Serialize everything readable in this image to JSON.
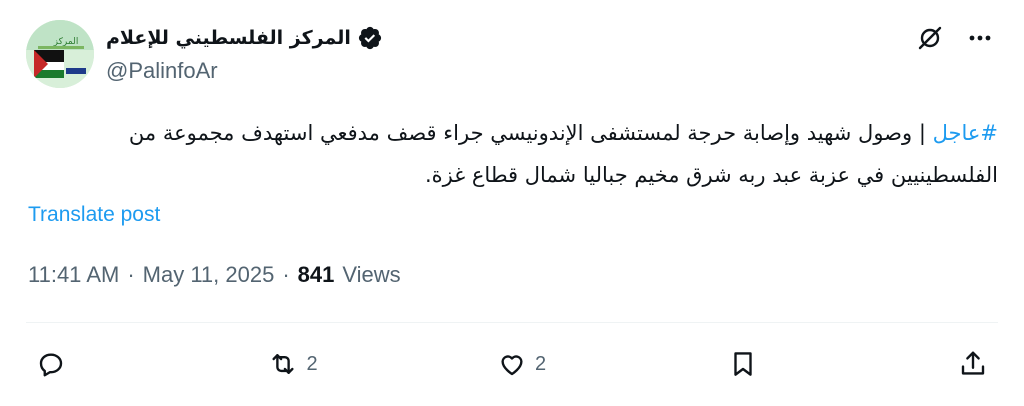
{
  "author": {
    "display_name": "المركز الفلسطيني للإعلام",
    "handle": "@PalinfoAr",
    "verified": true,
    "avatar_icon": "palinfo-logo-icon"
  },
  "post": {
    "hashtag": "#عاجل",
    "text": " | وصول شهيد وإصابة حرجة لمستشفى الإندونيسي جراء قصف مدفعي استهدف مجموعة من الفلسطينيين في عزبة عبد ربه شرق مخيم جباليا شمال قطاع غزة.",
    "translate_label": "Translate post"
  },
  "meta": {
    "time": "11:41 AM",
    "separator": "·",
    "date": "May 11, 2025",
    "views_count": "841",
    "views_label": "Views"
  },
  "actions": {
    "reply": {
      "icon": "reply-icon",
      "count": ""
    },
    "repost": {
      "icon": "repost-icon",
      "count": "2"
    },
    "like": {
      "icon": "heart-icon",
      "count": "2"
    },
    "bookmark": {
      "icon": "bookmark-icon",
      "count": ""
    },
    "share": {
      "icon": "share-icon",
      "count": ""
    }
  },
  "colors": {
    "link": "#1d9bf0",
    "secondary_text": "#536471",
    "primary_text": "#0f1419",
    "verified_badge": "#0f1419"
  }
}
